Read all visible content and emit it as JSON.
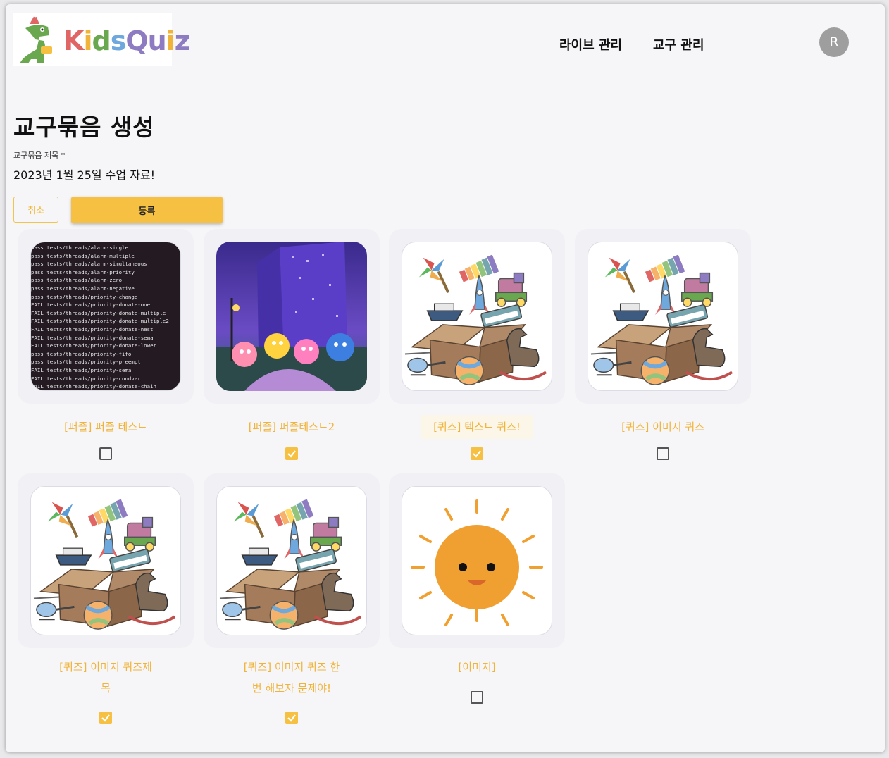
{
  "header": {
    "logo_text": "KidsQuiz",
    "nav": [
      "라이브 관리",
      "교구 관리"
    ],
    "avatar_initial": "R"
  },
  "form": {
    "page_title": "교구묶음 생성",
    "title_label": "교구묶음 제목 *",
    "title_value": "2023년 1월 25일 수업 자료!",
    "cancel_label": "취소",
    "register_label": "등록"
  },
  "colors": {
    "accent": "#f6c042",
    "accent_text": "#f1b43a"
  },
  "cards": [
    {
      "title": "[퍼즐] 퍼즐 테스트",
      "image": "terminal-screenshot",
      "checked": false
    },
    {
      "title": "[퍼즐] 퍼즐테스트2",
      "image": "pinkfong-poster",
      "checked": true
    },
    {
      "title": "[퀴즈] 텍스트 퀴즈!",
      "image": "toybox-illustration",
      "checked": true
    },
    {
      "title": "[퀴즈] 이미지 퀴즈",
      "image": "toybox-illustration",
      "checked": false
    },
    {
      "title_lines": [
        "[퀴즈] 이미지 퀴즈제",
        "목"
      ],
      "image": "toybox-illustration",
      "checked": true
    },
    {
      "title_lines": [
        "[퀴즈] 이미지 퀴즈 한",
        "번 해보자 문제야!"
      ],
      "image": "toybox-illustration",
      "checked": true
    },
    {
      "title": "[이미지]",
      "image": "sun-illustration",
      "checked": false
    }
  ],
  "terminal_lines": [
    "pass tests/threads/alarm-single",
    "pass tests/threads/alarm-multiple",
    "pass tests/threads/alarm-simultaneous",
    "pass tests/threads/alarm-priority",
    "pass tests/threads/alarm-zero",
    "pass tests/threads/alarm-negative",
    "pass tests/threads/priority-change",
    "FAIL tests/threads/priority-donate-one",
    "FAIL tests/threads/priority-donate-multiple",
    "FAIL tests/threads/priority-donate-multiple2",
    "FAIL tests/threads/priority-donate-nest",
    "FAIL tests/threads/priority-donate-sema",
    "FAIL tests/threads/priority-donate-lower",
    "pass tests/threads/priority-fifo",
    "pass tests/threads/priority-preempt",
    "FAIL tests/threads/priority-sema",
    "FAIL tests/threads/priority-condvar",
    "FAIL tests/threads/priority-donate-chain"
  ]
}
